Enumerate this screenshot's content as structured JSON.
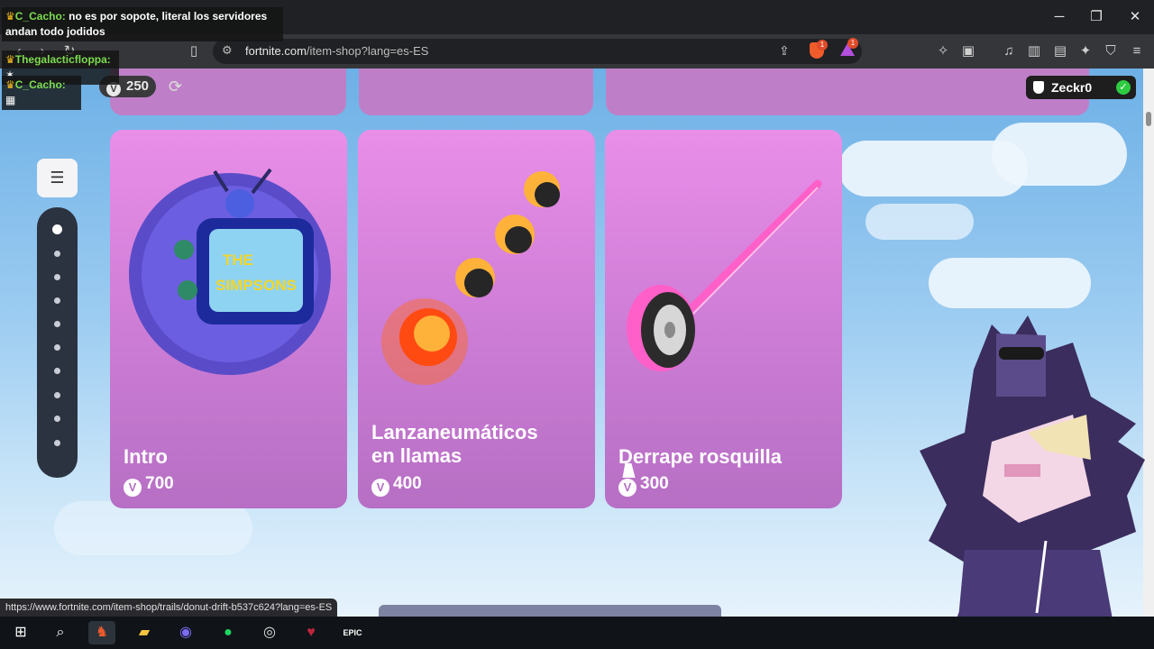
{
  "window": {
    "controls": {
      "minimize": "─",
      "maximize": "❐",
      "close": "✕"
    }
  },
  "browser": {
    "url_domain": "fortnite.com",
    "url_path": "/item-shop?lang=es-ES",
    "shields_count": "1",
    "rewards_count": "1"
  },
  "shop": {
    "vbucks_balance": "250",
    "vbucks_symbol": "V",
    "username": "Zeckr0",
    "verified_mark": "✓",
    "filter_icon": "☰",
    "cards": [
      {
        "title": "Intro",
        "price": "700"
      },
      {
        "title": "Lanzaneumáticos\nen llamas",
        "price": "400"
      },
      {
        "title": "Derrape rosquilla",
        "price": "300"
      }
    ]
  },
  "status_bar": {
    "link": "https://www.fortnite.com/item-shop/trails/donut-drift-b537c624?lang=es-ES"
  },
  "chat": [
    {
      "nick": "C_Cacho",
      "sep": ": ",
      "text": "no es por sopote, literal los servidores andan todo jodidos"
    },
    {
      "nick": "Thegalacticfloppa",
      "sep": ": ",
      "text": ""
    },
    {
      "nick": "C_Cacho",
      "sep": ": ",
      "text": ""
    }
  ],
  "taskbar": {
    "epic_label": "EPIC"
  }
}
